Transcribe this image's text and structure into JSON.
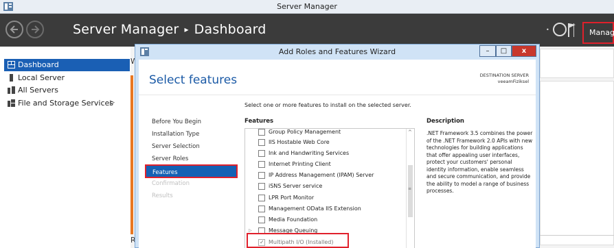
{
  "app": {
    "title": "Server Manager"
  },
  "header": {
    "app_name": "Server Manager",
    "separator": "▸",
    "page": "Dashboard",
    "manage_label": "Manage",
    "refresh_icon": "refresh-icon",
    "flag_icon": "flag-icon"
  },
  "sidebar": {
    "items": [
      {
        "label": "Dashboard",
        "icon": "dashboard-icon",
        "active": true
      },
      {
        "label": "Local Server",
        "icon": "server-icon",
        "active": false
      },
      {
        "label": "All Servers",
        "icon": "servers-icon",
        "active": false
      },
      {
        "label": "File and Storage Services",
        "icon": "storage-icon",
        "active": false,
        "arrow": "▷"
      }
    ]
  },
  "background": {
    "w_letter": "W",
    "r_letter": "R"
  },
  "wizard": {
    "title": "Add Roles and Features Wizard",
    "page_title": "Select features",
    "destination_label": "DESTINATION SERVER",
    "destination_value": "veeamFiziksel",
    "steps": [
      {
        "label": "Before You Begin",
        "state": "normal"
      },
      {
        "label": "Installation Type",
        "state": "normal"
      },
      {
        "label": "Server Selection",
        "state": "normal"
      },
      {
        "label": "Server Roles",
        "state": "normal"
      },
      {
        "label": "Features",
        "state": "active"
      },
      {
        "label": "Confirmation",
        "state": "disabled"
      },
      {
        "label": "Results",
        "state": "disabled"
      }
    ],
    "instruction": "Select one or more features to install on the selected server.",
    "features_header": "Features",
    "description_header": "Description",
    "description_text": ".NET Framework 3.5 combines the power of the .NET Framework 2.0 APIs with new technologies for building applications that offer appealing user interfaces, protect your customers' personal identity information, enable seamless and secure communication, and provide the ability to model a range of business processes.",
    "features": [
      {
        "label": "Group Policy Management",
        "checked": false
      },
      {
        "label": "IIS Hostable Web Core",
        "checked": false
      },
      {
        "label": "Ink and Handwriting Services",
        "checked": false
      },
      {
        "label": "Internet Printing Client",
        "checked": false
      },
      {
        "label": "IP Address Management (IPAM) Server",
        "checked": false
      },
      {
        "label": "iSNS Server service",
        "checked": false
      },
      {
        "label": "LPR Port Monitor",
        "checked": false
      },
      {
        "label": "Management OData IIS Extension",
        "checked": false
      },
      {
        "label": "Media Foundation",
        "checked": false
      },
      {
        "label": "Message Queuing",
        "checked": false,
        "expander": "▷"
      },
      {
        "label": "Multipath I/O (Installed)",
        "checked": true,
        "installed": true
      }
    ],
    "buttons": {
      "minimize": "–",
      "maximize": "□",
      "close": "x"
    }
  }
}
